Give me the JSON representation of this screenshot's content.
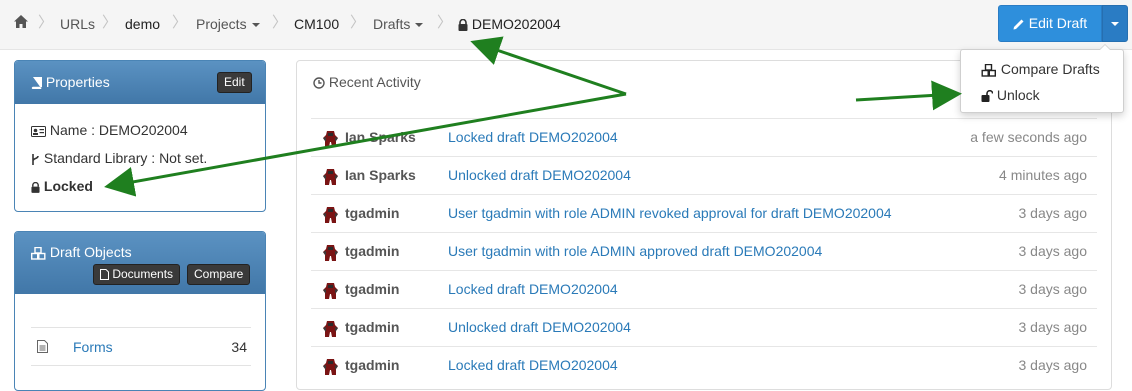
{
  "breadcrumb": {
    "items": [
      "URLs",
      "demo",
      "Projects",
      "CM100",
      "Drafts",
      "DEMO202004"
    ]
  },
  "toolbar": {
    "edit_label": "Edit Draft",
    "menu": [
      "Compare Drafts",
      "Unlock"
    ]
  },
  "properties": {
    "title": "Properties",
    "edit_label": "Edit",
    "name": "Name : DEMO202004",
    "library": "Standard Library : Not set.",
    "status": "Locked"
  },
  "draft_objects": {
    "title": "Draft Objects",
    "documents_label": "Documents",
    "compare_label": "Compare",
    "items": [
      {
        "label": "Forms",
        "count": "34"
      }
    ]
  },
  "activity": {
    "title": "Recent Activity",
    "rows": [
      {
        "user": "Ian Sparks",
        "message": "Locked draft DEMO202004",
        "time": "a few seconds ago"
      },
      {
        "user": "Ian Sparks",
        "message": "Unlocked draft DEMO202004",
        "time": "4 minutes ago"
      },
      {
        "user": "tgadmin",
        "message": "User tgadmin with role ADMIN revoked approval for draft DEMO202004",
        "time": "3 days ago"
      },
      {
        "user": "tgadmin",
        "message": "User tgadmin with role ADMIN approved draft DEMO202004",
        "time": "3 days ago"
      },
      {
        "user": "tgadmin",
        "message": "Locked draft DEMO202004",
        "time": "3 days ago"
      },
      {
        "user": "tgadmin",
        "message": "Unlocked draft DEMO202004",
        "time": "3 days ago"
      },
      {
        "user": "tgadmin",
        "message": "Locked draft DEMO202004",
        "time": "3 days ago"
      }
    ]
  },
  "colors": {
    "primary": "#2e8fdc",
    "panel_header": "#4a84b5",
    "link": "#2a7ab8",
    "annotation_arrow": "#1f7f1f"
  },
  "icons": [
    "home-icon",
    "lock-icon",
    "pencil-icon",
    "book-icon",
    "id-card-icon",
    "branch-icon",
    "cubes-icon",
    "document-icon",
    "clock-icon",
    "unlock-icon",
    "avatar-icon"
  ]
}
